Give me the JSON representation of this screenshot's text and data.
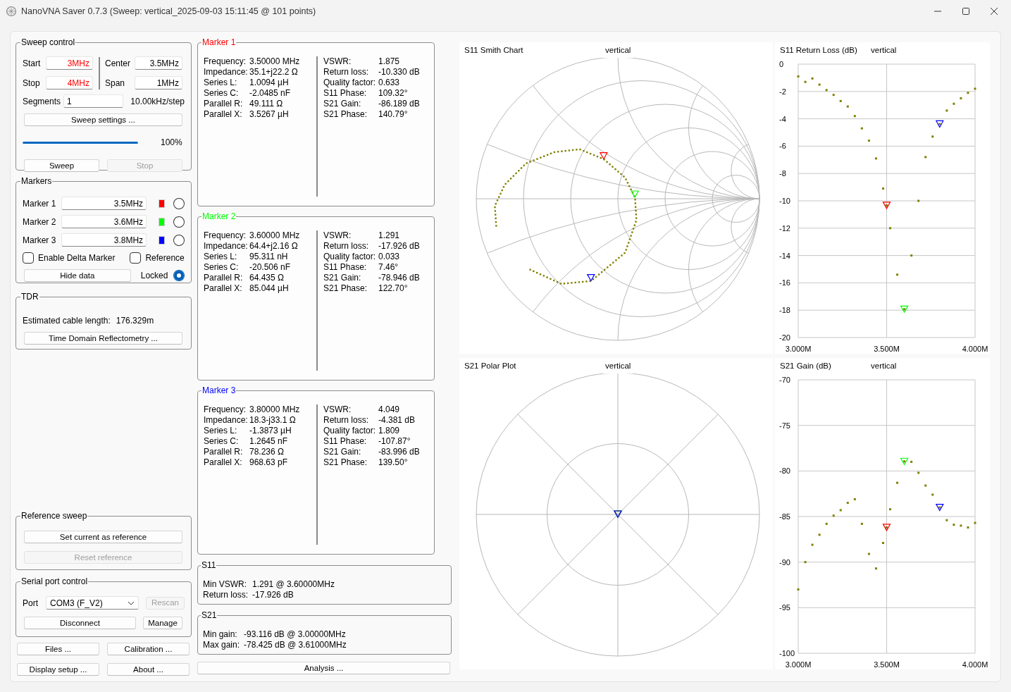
{
  "window": {
    "title": "NanoVNA Saver 0.7.3 (Sweep: vertical_2025-09-03 15:11:45 @ 101 points)"
  },
  "sweep_control": {
    "title": "Sweep control",
    "fields": [
      {
        "label": "Start",
        "value": "3MHz",
        "color": "#ff0000"
      },
      {
        "label": "Center",
        "value": "3.5MHz",
        "color": "#000000"
      },
      {
        "label": "Stop",
        "value": "4MHz",
        "color": "#ff0000"
      },
      {
        "label": "Span",
        "value": "1MHz",
        "color": "#000000"
      }
    ],
    "segments": {
      "label": "Segments",
      "value": "1"
    },
    "step": "10.00kHz/step",
    "settings_button": "Sweep settings ...",
    "progress": {
      "level": 1.0,
      "reading": "100%"
    },
    "buttons": [
      {
        "label": "Sweep",
        "disabled": false
      },
      {
        "label": "Stop",
        "disabled": true
      }
    ]
  },
  "markers": {
    "title": "Markers",
    "items": [
      {
        "label": "Marker 1",
        "value": "3.5MHz",
        "color": "#ff0000",
        "selected": false
      },
      {
        "label": "Marker 2",
        "value": "3.6MHz",
        "color": "#00ff00",
        "selected": false
      },
      {
        "label": "Marker 3",
        "value": "3.8MHz",
        "color": "#0000ff",
        "selected": false
      }
    ],
    "delta": {
      "label": "Enable Delta Marker",
      "checked": false
    },
    "reference": {
      "label": "Reference",
      "checked": false
    },
    "hide_button": "Hide data",
    "locked": {
      "label": "Locked",
      "checked": true
    }
  },
  "tdr": {
    "title": "TDR",
    "label": "Estimated cable length:",
    "value": "176.329m",
    "button": "Time Domain Reflectometry ..."
  },
  "reference_sweep": {
    "title": "Reference sweep",
    "buttons": [
      {
        "label": "Set current as reference",
        "disabled": false
      },
      {
        "label": "Reset reference",
        "disabled": true
      }
    ]
  },
  "serial_port": {
    "title": "Serial port control",
    "port_label": "Port",
    "port_value": "COM3 (F_V2)",
    "buttons": [
      {
        "label": "Rescan",
        "disabled": true
      },
      {
        "label": "Disconnect",
        "disabled": false
      },
      {
        "label": "Manage",
        "disabled": false
      }
    ]
  },
  "bottom_buttons": [
    "Files ...",
    "Calibration ...",
    "Display setup ...",
    "About ..."
  ],
  "marker_details": [
    {
      "title": "Marker 1",
      "color": "#ff0000",
      "left": [
        {
          "label": "Frequency:",
          "value": "3.50000 MHz"
        },
        {
          "label": "Impedance:",
          "value": "35.1+j22.2 Ω"
        },
        {
          "label": "Series L:",
          "value": "1.0094 µH"
        },
        {
          "label": "Series C:",
          "value": "-2.0485 nF"
        },
        {
          "label": "Parallel R:",
          "value": "49.111 Ω"
        },
        {
          "label": "Parallel X:",
          "value": "3.5267 µH"
        }
      ],
      "right": [
        {
          "label": "VSWR:",
          "value": "1.875"
        },
        {
          "label": "Return loss:",
          "value": "-10.330 dB"
        },
        {
          "label": "Quality factor:",
          "value": "0.633"
        },
        {
          "label": "S11 Phase:",
          "value": "109.32°"
        },
        {
          "label": "S21 Gain:",
          "value": "-86.189 dB"
        },
        {
          "label": "S21 Phase:",
          "value": "140.79°"
        }
      ]
    },
    {
      "title": "Marker 2",
      "color": "#00ff00",
      "left": [
        {
          "label": "Frequency:",
          "value": "3.60000 MHz"
        },
        {
          "label": "Impedance:",
          "value": "64.4+j2.16 Ω"
        },
        {
          "label": "Series L:",
          "value": "95.311 nH"
        },
        {
          "label": "Series C:",
          "value": "-20.506 nF"
        },
        {
          "label": "Parallel R:",
          "value": "64.435 Ω"
        },
        {
          "label": "Parallel X:",
          "value": "85.044 µH"
        }
      ],
      "right": [
        {
          "label": "VSWR:",
          "value": "1.291"
        },
        {
          "label": "Return loss:",
          "value": "-17.926 dB"
        },
        {
          "label": "Quality factor:",
          "value": "0.033"
        },
        {
          "label": "S11 Phase:",
          "value": "7.46°"
        },
        {
          "label": "S21 Gain:",
          "value": "-78.946 dB"
        },
        {
          "label": "S21 Phase:",
          "value": "122.70°"
        }
      ]
    },
    {
      "title": "Marker 3",
      "color": "#0000ff",
      "left": [
        {
          "label": "Frequency:",
          "value": "3.80000 MHz"
        },
        {
          "label": "Impedance:",
          "value": "18.3-j33.1 Ω"
        },
        {
          "label": "Series L:",
          "value": "-1.3873 µH"
        },
        {
          "label": "Series C:",
          "value": "1.2645 nF"
        },
        {
          "label": "Parallel R:",
          "value": "78.236 Ω"
        },
        {
          "label": "Parallel X:",
          "value": "968.63 pF"
        }
      ],
      "right": [
        {
          "label": "VSWR:",
          "value": "4.049"
        },
        {
          "label": "Return loss:",
          "value": "-4.381 dB"
        },
        {
          "label": "Quality factor:",
          "value": "1.809"
        },
        {
          "label": "S11 Phase:",
          "value": "-107.87°"
        },
        {
          "label": "S21 Gain:",
          "value": "-83.996 dB"
        },
        {
          "label": "S21 Phase:",
          "value": "139.50°"
        }
      ]
    }
  ],
  "summaries": [
    {
      "title": "S11",
      "lines": [
        {
          "label": "Min VSWR:",
          "value": "1.291 @ 3.60000MHz"
        },
        {
          "label": "Return loss:",
          "value": "-17.926 dB"
        }
      ]
    },
    {
      "title": "S21",
      "lines": [
        {
          "label": "Min gain:",
          "value": "-93.116 dB @ 3.00000MHz"
        },
        {
          "label": "Max gain:",
          "value": "-78.425 dB @ 3.61000MHz"
        }
      ]
    }
  ],
  "analysis_button": "Analysis ...",
  "charts": [
    {
      "kind": "smith",
      "title": "S11 Smith Chart",
      "subtitle": "vertical"
    },
    {
      "kind": "line",
      "title": "S11 Return Loss (dB)",
      "subtitle": "vertical",
      "chart_data": {
        "type": "scatter",
        "x": [
          3.0,
          3.04,
          3.08,
          3.12,
          3.16,
          3.2,
          3.24,
          3.28,
          3.32,
          3.36,
          3.4,
          3.44,
          3.48,
          3.5,
          3.52,
          3.56,
          3.6,
          3.64,
          3.68,
          3.72,
          3.76,
          3.8,
          3.84,
          3.88,
          3.92,
          3.96,
          4.0
        ],
        "series": [
          {
            "color": "#808000",
            "values": [
              -0.9,
              -1.3,
              -1.05,
              -1.5,
              -1.9,
              -2.25,
              -2.7,
              -3.1,
              -3.8,
              -4.7,
              -5.6,
              -6.9,
              -9.1,
              -10.33,
              -12.0,
              -15.4,
              -17.93,
              -14.0,
              -10.0,
              -6.8,
              -5.3,
              -4.38,
              -3.4,
              -2.9,
              -2.5,
              -2.1,
              -1.8
            ]
          },
          {
            "color": "#ff0000",
            "values": [
              null,
              null,
              null,
              null,
              null,
              null,
              null,
              null,
              null,
              null,
              null,
              null,
              null,
              -10.33,
              null,
              null,
              null,
              null,
              null,
              null,
              null,
              null,
              null,
              null,
              null,
              null,
              null
            ]
          },
          {
            "color": "#00ff00",
            "values": [
              null,
              null,
              null,
              null,
              null,
              null,
              null,
              null,
              null,
              null,
              null,
              null,
              null,
              null,
              null,
              null,
              -17.93,
              null,
              null,
              null,
              null,
              null,
              null,
              null,
              null,
              null,
              null
            ]
          },
          {
            "color": "#0000ff",
            "values": [
              null,
              null,
              null,
              null,
              null,
              null,
              null,
              null,
              null,
              null,
              null,
              null,
              null,
              null,
              null,
              null,
              null,
              null,
              null,
              null,
              null,
              -4.38,
              null,
              null,
              null,
              null,
              null
            ]
          }
        ],
        "grid": true,
        "xlim": [
          3.0,
          4.0
        ],
        "ylim": [
          -20,
          0
        ],
        "xticks": [
          {
            "value": 3.0,
            "label": "3.000M"
          },
          {
            "value": 3.5,
            "label": "3.500M"
          },
          {
            "value": 4.0,
            "label": "4.000M"
          }
        ],
        "yticks": [
          0,
          -2,
          -4,
          -6,
          -8,
          -10,
          -12,
          -14,
          -16,
          -18,
          -20
        ]
      }
    },
    {
      "kind": "polar",
      "title": "S21 Polar Plot",
      "subtitle": "vertical"
    },
    {
      "kind": "line",
      "title": "S21 Gain (dB)",
      "subtitle": "vertical",
      "chart_data": {
        "type": "scatter",
        "x": [
          3.0,
          3.04,
          3.08,
          3.12,
          3.16,
          3.2,
          3.24,
          3.28,
          3.32,
          3.36,
          3.4,
          3.44,
          3.48,
          3.5,
          3.52,
          3.56,
          3.6,
          3.64,
          3.68,
          3.72,
          3.76,
          3.8,
          3.84,
          3.88,
          3.92,
          3.96,
          4.0
        ],
        "series": [
          {
            "color": "#808000",
            "values": [
              -93.0,
              -90.0,
              -88.1,
              -87.0,
              -85.8,
              -84.9,
              -84.3,
              -83.5,
              -83.1,
              -85.8,
              -89.1,
              -90.7,
              -87.9,
              -86.19,
              -84.2,
              -81.3,
              -78.95,
              -79.0,
              -80.2,
              -81.6,
              -82.6,
              -84.0,
              -85.4,
              -85.9,
              -86.0,
              -86.2,
              -85.7
            ]
          },
          {
            "color": "#ff0000",
            "values": [
              null,
              null,
              null,
              null,
              null,
              null,
              null,
              null,
              null,
              null,
              null,
              null,
              null,
              -86.19,
              null,
              null,
              null,
              null,
              null,
              null,
              null,
              null,
              null,
              null,
              null,
              null,
              null
            ]
          },
          {
            "color": "#00ff00",
            "values": [
              null,
              null,
              null,
              null,
              null,
              null,
              null,
              null,
              null,
              null,
              null,
              null,
              null,
              null,
              null,
              null,
              -78.95,
              null,
              null,
              null,
              null,
              null,
              null,
              null,
              null,
              null,
              null
            ]
          },
          {
            "color": "#0000ff",
            "values": [
              null,
              null,
              null,
              null,
              null,
              null,
              null,
              null,
              null,
              null,
              null,
              null,
              null,
              null,
              null,
              null,
              null,
              null,
              null,
              null,
              null,
              -84.0,
              null,
              null,
              null,
              null,
              null
            ]
          }
        ],
        "grid": true,
        "xlim": [
          3.0,
          4.0
        ],
        "ylim": [
          -100,
          -70
        ],
        "xticks": [
          {
            "value": 3.0,
            "label": "3.000M"
          },
          {
            "value": 3.5,
            "label": "3.500M"
          },
          {
            "value": 4.0,
            "label": "4.000M"
          }
        ],
        "yticks": [
          -70,
          -75,
          -80,
          -85,
          -90,
          -95,
          -100
        ]
      }
    }
  ]
}
